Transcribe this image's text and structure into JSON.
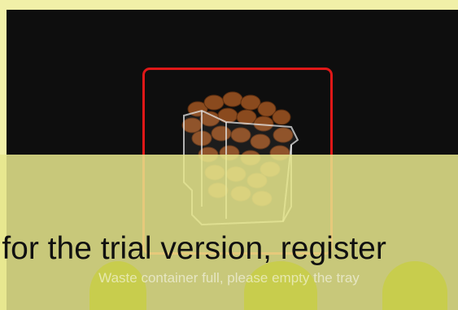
{
  "dialog": {
    "message": "Waste container full, please empty the tray"
  },
  "trial_banner": {
    "text": "k for the trial version, register"
  },
  "colors": {
    "highlight": "#e01818",
    "background": "#0e0e0e",
    "overlay": "#e6e68c"
  },
  "icons": {
    "illustration": "waste-container-icon"
  }
}
